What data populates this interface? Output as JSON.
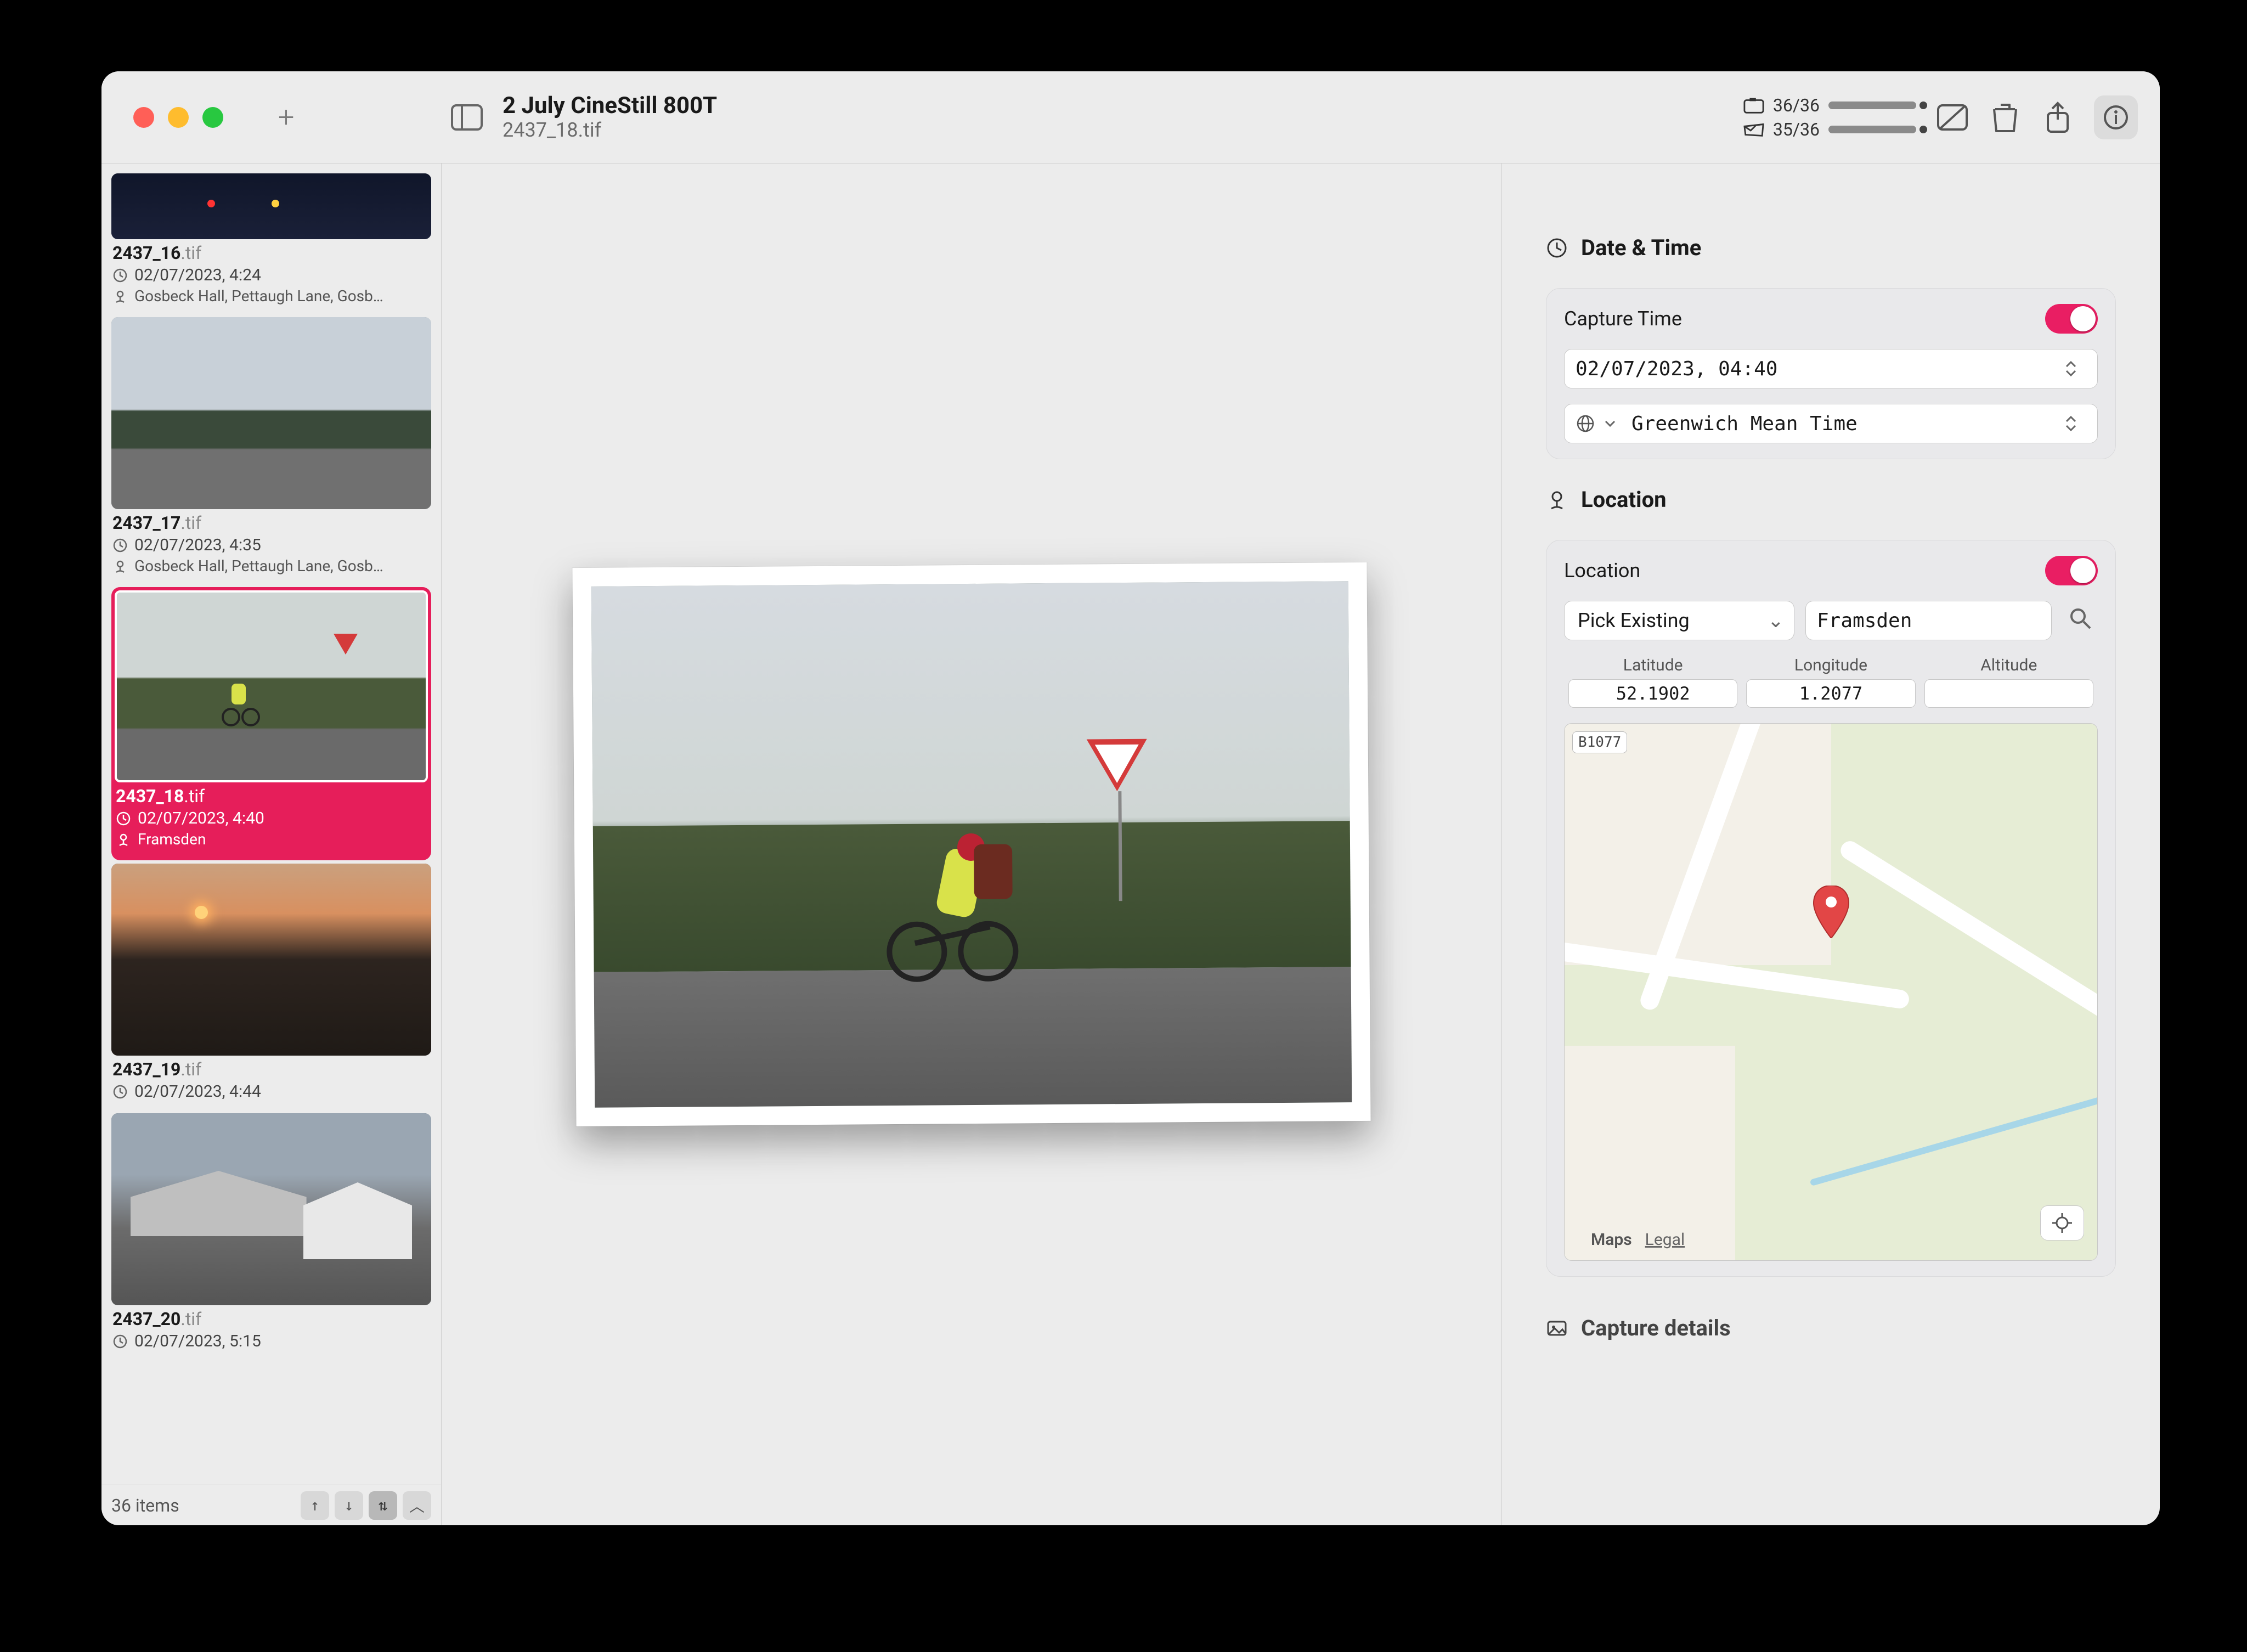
{
  "header": {
    "title": "2 July CineStill 800T",
    "subtitle": "2437_18.tif",
    "counter_photos": "36/36",
    "counter_located": "35/36"
  },
  "sidebar": {
    "items": [
      {
        "base": "2437_16",
        "ext": ".tif",
        "date": "02/07/2023, 4:24",
        "location": "Gosbeck Hall, Pettaugh Lane, Gosb…",
        "thumb_h": 120,
        "bg": "#1a1d2a"
      },
      {
        "base": "2437_17",
        "ext": ".tif",
        "date": "02/07/2023, 4:35",
        "location": "Gosbeck Hall, Pettaugh Lane, Gosb…",
        "thumb_h": 350,
        "bg": "#7b8a88"
      },
      {
        "base": "2437_18",
        "ext": ".tif",
        "date": "02/07/2023, 4:40",
        "location": "Framsden",
        "thumb_h": 350,
        "bg": "#8b9a8a",
        "selected": true
      },
      {
        "base": "2437_19",
        "ext": ".tif",
        "date": "02/07/2023, 4:44",
        "location": "",
        "thumb_h": 350,
        "bg": "#3b2e2a"
      },
      {
        "base": "2437_20",
        "ext": ".tif",
        "date": "02/07/2023, 5:15",
        "location": "",
        "thumb_h": 350,
        "bg": "#5b6a72"
      }
    ],
    "footer_count": "36 items"
  },
  "inspector": {
    "datetime": {
      "section": "Date & Time",
      "label": "Capture Time",
      "value": "02/07/2023, 04:40",
      "timezone": "Greenwich Mean Time"
    },
    "location": {
      "section": "Location",
      "label": "Location",
      "picker_label": "Pick Existing",
      "search_value": "Framsden",
      "lat_label": "Latitude",
      "lat_value": "52.1902",
      "lon_label": "Longitude",
      "lon_value": "1.2077",
      "alt_label": "Altitude",
      "alt_value": "",
      "map_attrib": "Maps",
      "map_legal": "Legal",
      "road_tag": "B1077"
    },
    "capture_details": "Capture details"
  }
}
